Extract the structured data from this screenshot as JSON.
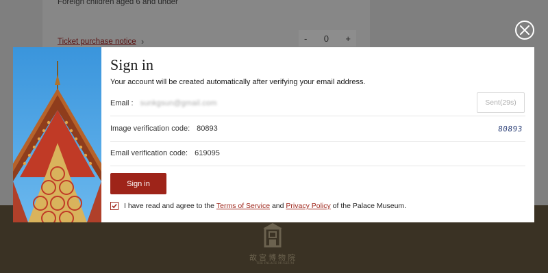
{
  "background": {
    "foreign_children_label": "Foreign children aged 6 and under",
    "ticket_notice_link": "Ticket purchase notice",
    "stepper": {
      "minus": "-",
      "value": "0",
      "plus": "+"
    },
    "footer": {
      "chinese_name": "故宫博物院",
      "english_name": "THE PALACE MUSEUM"
    }
  },
  "modal": {
    "title": "Sign in",
    "subtitle": "Your account will be created automatically after verifying your email address.",
    "email": {
      "label": "Email :",
      "value": "sunkgsun@gmail.com"
    },
    "send_button": "Sent(29s)",
    "image_code": {
      "label": "Image verification code:",
      "value": "80893",
      "captcha_text": "80893"
    },
    "email_code": {
      "label": "Email verification code:",
      "value": "619095"
    },
    "signin_button": "Sign in",
    "agreement": {
      "checked": true,
      "prefix": "I have read and agree to the ",
      "terms_link": "Terms of Service",
      "and": " and ",
      "privacy_link": "Privacy Policy",
      "suffix": " of the Palace Museum."
    }
  },
  "colors": {
    "accent": "#9e2419",
    "overlay": "#7f7f7f",
    "footer": "#3a3224"
  },
  "icons": {
    "close": "close-circle-icon",
    "chevron": "chevron-right-icon",
    "checkbox": "check-icon",
    "footer_logo": "palace-museum-logo-icon"
  }
}
